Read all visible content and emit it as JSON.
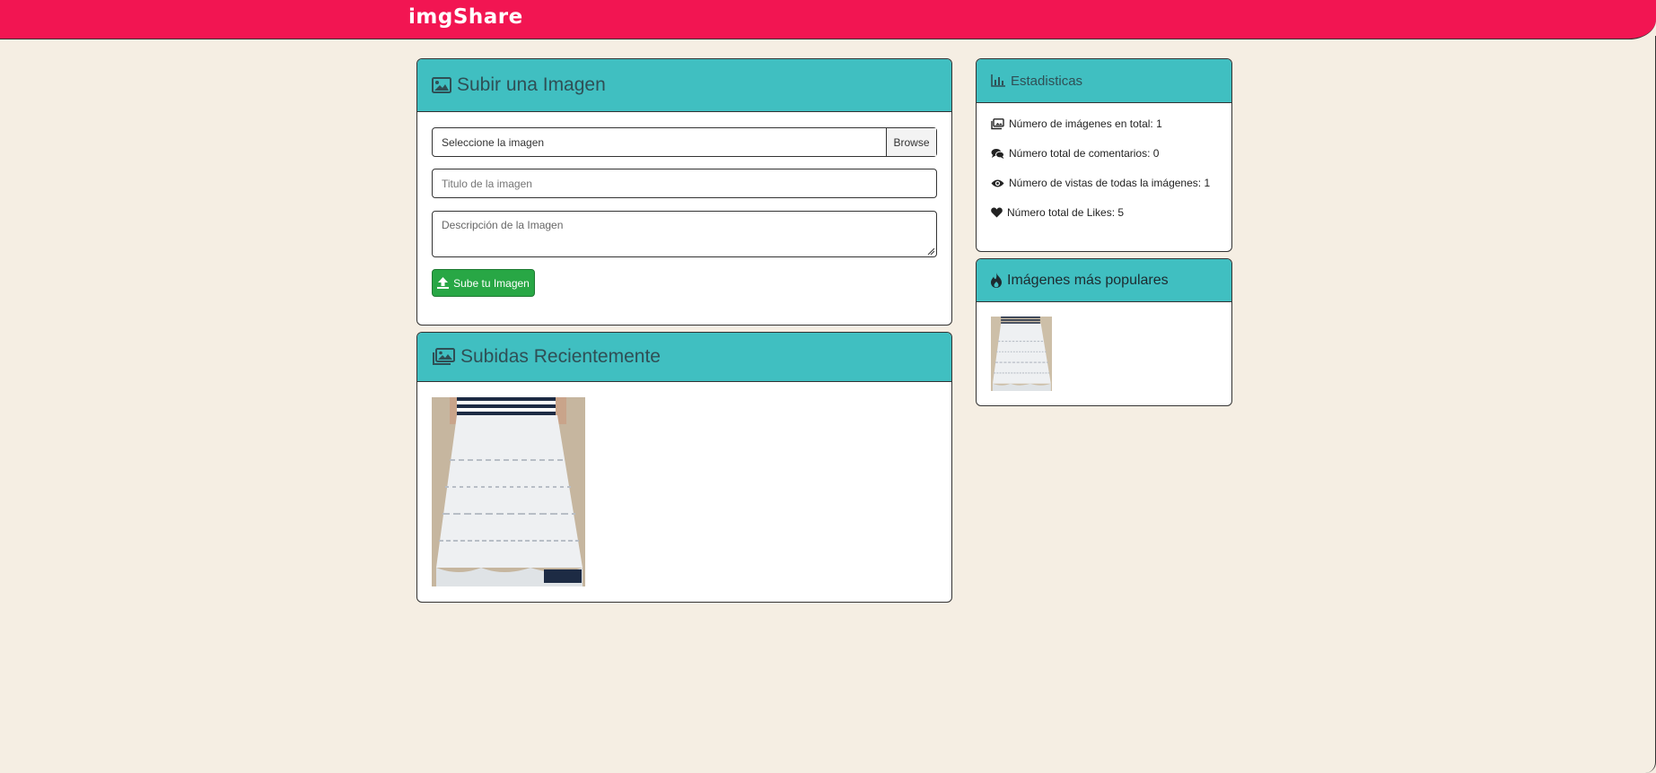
{
  "app": {
    "brand": "imgShare"
  },
  "upload": {
    "title": "Subir una Imagen",
    "icon": "image-icon",
    "file_label": "Seleccione la imagen",
    "browse_label": "Browse",
    "title_placeholder": "Titulo de la imagen",
    "description_placeholder": "Descripción de la Imagen",
    "submit_label": "Sube tu Imagen",
    "submit_icon": "upload-icon"
  },
  "recent": {
    "title": "Subidas Recientemente",
    "icon": "images-icon",
    "images": [
      {
        "alt": "white knit lace maxi skirt"
      }
    ]
  },
  "stats": {
    "title": "Estadisticas",
    "icon": "bar-chart-icon",
    "items": [
      {
        "icon": "images-icon",
        "label": "Número de imágenes en total: 1"
      },
      {
        "icon": "comments-icon",
        "label": "Número total de comentarios: 0"
      },
      {
        "icon": "eye-icon",
        "label": "Número de vistas de todas la imágenes: 1"
      },
      {
        "icon": "heart-icon",
        "label": "Número total de Likes: 5"
      }
    ]
  },
  "popular": {
    "title": "Imágenes más populares",
    "icon": "fire-icon",
    "images": [
      {
        "alt": "white knit lace maxi skirt"
      }
    ]
  },
  "colors": {
    "navbar": "#f21552",
    "card_header": "#40bfc1",
    "background": "#f5eee3",
    "success_button": "#28a745"
  }
}
